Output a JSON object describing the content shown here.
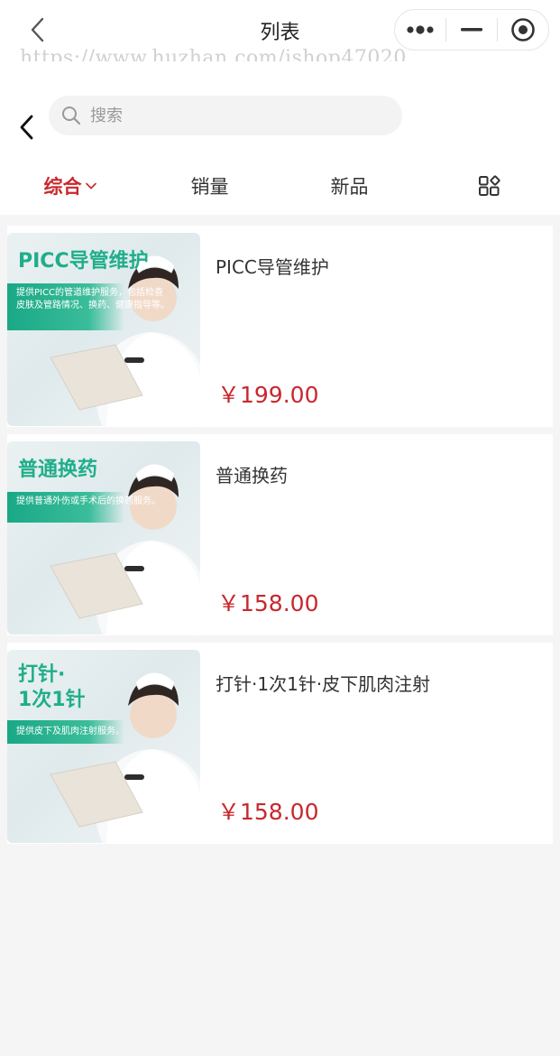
{
  "navbar": {
    "title": "列表",
    "watermark": "https://www.huzhan.com/ishop47020",
    "back_icon": "chevron-left-icon",
    "capsule_icons": [
      "more-dots-icon",
      "minimize-icon",
      "target-close-icon"
    ]
  },
  "search": {
    "placeholder": "搜索",
    "value": "",
    "icon": "search-icon"
  },
  "tabs": [
    {
      "label": "综合",
      "active": true,
      "icon": "chevron-down-icon"
    },
    {
      "label": "销量",
      "active": false
    },
    {
      "label": "新品",
      "active": false
    },
    {
      "label": "",
      "icon": "grid-layout-icon"
    }
  ],
  "products": [
    {
      "title": "PICC导管维护",
      "price": "￥199.00",
      "image_title": "PICC导管维护",
      "image_desc": "提供PICC的管道维护服务，包括检查皮肤及管路情况、换药、健康指导等。"
    },
    {
      "title": "普通换药",
      "price": "￥158.00",
      "image_title": "普通换药",
      "image_desc": "提供普通外伤或手术后的换药服务。"
    },
    {
      "title": "打针·1次1针·皮下肌肉注射",
      "price": "￥158.00",
      "image_title_line1": "打针·",
      "image_title_line2": "1次1针",
      "image_desc": "提供皮下及肌肉注射服务。"
    }
  ],
  "colors": {
    "accent": "#c8282e",
    "brand_green": "#1fae8a",
    "background": "#f5f5f5"
  }
}
